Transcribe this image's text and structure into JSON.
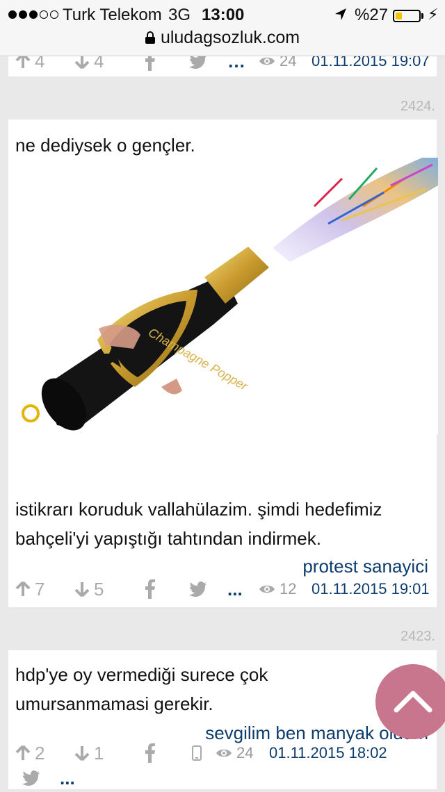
{
  "status_bar": {
    "carrier": "Turk Telekom",
    "network": "3G",
    "time": "13:00",
    "battery": "%27",
    "battery_level": 0.27,
    "url": "uludagsozluk.com"
  },
  "entries": [
    {
      "up": "4",
      "down": "4",
      "views": "24",
      "date": "01.11.2015 19:07"
    },
    {
      "number": "2424.",
      "text_top": "ne dediysek o gençler.",
      "image_labels": {
        "brand": "Champagne Popper"
      },
      "text_bottom": "istikrarı koruduk vallahülazim. şimdi hedefimiz bahçeli'yi yapıştığı tahtından indirmek.",
      "author": "protest sanayici",
      "up": "7",
      "down": "5",
      "more": "...",
      "views": "12",
      "date": "01.11.2015 19:01"
    },
    {
      "number": "2423.",
      "text": "hdp'ye oy vermediği surece çok umursanmamasi gerekir.",
      "author": "sevgilim ben manyak oldum",
      "up": "2",
      "down": "1",
      "more": "...",
      "views": "24",
      "date": "01.11.2015 18:02"
    }
  ],
  "icons": {
    "upvote": "arrow-up-icon",
    "downvote": "arrow-down-icon",
    "facebook": "facebook-icon",
    "twitter": "twitter-icon",
    "views": "eye-icon",
    "mobile": "mobile-icon",
    "scroll_top": "chevron-up-icon"
  },
  "colors": {
    "link": "#0d3c6e",
    "fab": "#c8768e",
    "battery": "#f5c400"
  }
}
